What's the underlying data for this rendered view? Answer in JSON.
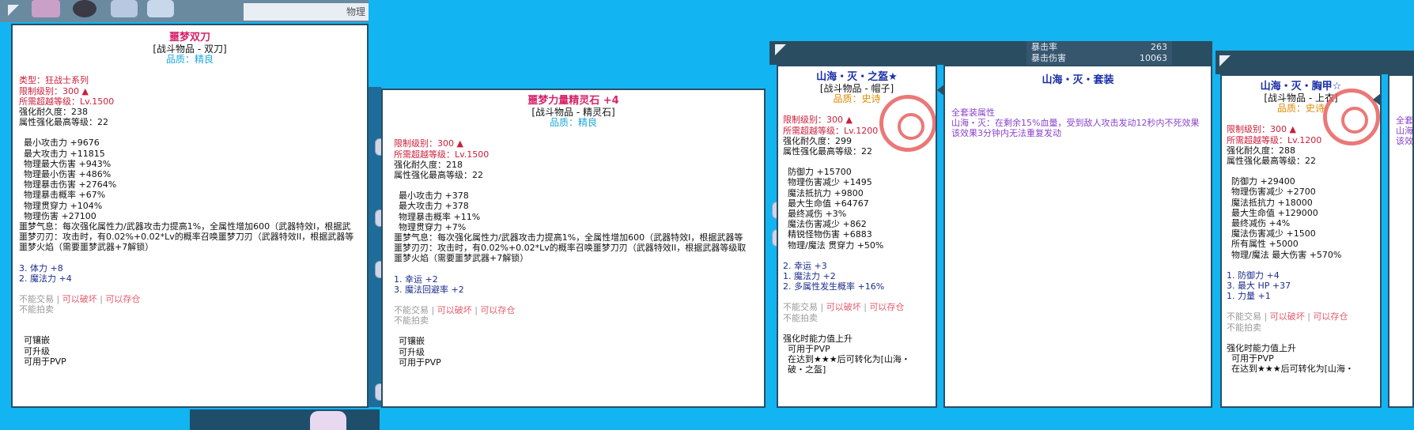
{
  "screen": {
    "background": "#13b4f2"
  },
  "top_strip": {
    "label": "物理"
  },
  "top_strip2": {
    "rows": [
      {
        "label": "暴击率",
        "value": "263"
      },
      {
        "label": "暴击伤害",
        "value": "10063"
      }
    ]
  },
  "tip1": {
    "name": "噩梦双刀",
    "category": "[战斗物品 - 双刀]",
    "quality": "品质：精良",
    "type_line": "类型：狂战士系列",
    "req_level": "限制级别：300 ▲",
    "req_exceed": "所需超越等级：Lv.1500",
    "durability": "强化耐久度：238",
    "attr_max": "属性强化最高等级：22",
    "stats": [
      "最小攻击力 +9676",
      "最大攻击力 +11815",
      "物理最大伤害 +943%",
      "物理最小伤害 +486%",
      "物理暴击伤害 +2764%",
      "物理暴击概率 +67%",
      "物理贯穿力 +104%",
      "物理伤害 +27100"
    ],
    "effects": [
      "噩梦气息：每次强化属性力/武器攻击力提高1%，全属性增加600（武器特效I，根据武",
      "噩梦刃刃：攻击时，有0.02%+0.02*Lv的概率召唤噩梦刀刃（武器特效II，根据武器等",
      "噩梦火焰（需要噩梦武器+7解锁）"
    ],
    "bonus": [
      "3. 体力 +8",
      "2. 魔法力 +4"
    ],
    "trade": {
      "no_trade": "不能交易",
      "sep": "|",
      "breakable": "可以破坏",
      "storable": "可以存仓",
      "no_auction": "不能拍卖"
    },
    "abilities": [
      "可镶嵌",
      "可升级",
      "可用于PVP"
    ]
  },
  "tip2": {
    "name": "噩梦力量精灵石 +4",
    "category": "[战斗物品 - 精灵石]",
    "quality": "品质：精良",
    "req_level": "限制级别：300 ▲",
    "req_exceed": "所需超越等级：Lv.1500",
    "durability": "强化耐久度：218",
    "attr_max": "属性强化最高等级：22",
    "stats": [
      "最小攻击力 +378",
      "最大攻击力 +378",
      "物理暴击概率 +11%",
      "物理贯穿力 +7%"
    ],
    "effects": [
      "噩梦气息：每次强化属性力/武器攻击力提高1%，全属性增加600（武器特效I，根据武器等",
      "噩梦刃刃：攻击时，有0.02%+0.02*Lv的概率召唤噩梦刀刃（武器特效II，根据武器等级取",
      "噩梦火焰（需要噩梦武器+7解锁）"
    ],
    "bonus": [
      "1. 幸运 +2",
      "3. 魔法回避率 +2"
    ],
    "trade": {
      "no_trade": "不能交易",
      "sep": "|",
      "breakable": "可以破坏",
      "storable": "可以存仓",
      "no_auction": "不能拍卖"
    },
    "abilities": [
      "可镶嵌",
      "可升级",
      "可用于PVP"
    ]
  },
  "tip3": {
    "name": "山海・灭・之盔★",
    "category": "[战斗物品 - 帽子]",
    "quality": "品质：史诗",
    "req_level": "限制级别：300 ▲",
    "req_exceed": "所需超越等级：Lv.1200",
    "durability": "强化耐久度：299",
    "attr_max": "属性强化最高等级：22",
    "stats": [
      "防御力 +15700",
      "物理伤害减少 +1495",
      "魔法抵抗力 +9800",
      "最大生命值 +64767",
      "最终减伤 +3%",
      "魔法伤害减少 +862",
      "精锐怪物伤害 +6883",
      "物理/魔法 贯穿力 +50%"
    ],
    "bonus": [
      "2. 幸运 +3",
      "1. 魔法力 +2",
      "2. 多属性发生概率 +16%"
    ],
    "trade": {
      "no_trade": "不能交易",
      "sep": "|",
      "breakable": "可以破坏",
      "storable": "可以存仓",
      "no_auction": "不能拍卖"
    },
    "upgrade": [
      "强化时能力值上升",
      "可用于PVP",
      "在达到★★★后可转化为[山海・",
      "破・之盔]"
    ]
  },
  "setpanel": {
    "title": "山海・灭・套装",
    "full_set": "全套装属性",
    "effect1": "山海・灭：在剩余15%血量，受到敌人攻击发动12秒内不死效果",
    "effect2": "该效果3分钟内无法重复发动"
  },
  "tip4": {
    "name": "山海・灭・胸甲☆",
    "category": "[战斗物品 - 上衣]",
    "quality": "品质：史诗",
    "req_level": "限制级别：300 ▲",
    "req_exceed": "所需超越等级：Lv.1200",
    "durability": "强化耐久度：288",
    "attr_max": "属性强化最高等级：22",
    "stats": [
      "防御力 +29400",
      "物理伤害减少 +2700",
      "魔法抵抗力 +18000",
      "最大生命值 +129000",
      "最终减伤 +4%",
      "魔法伤害减少 +1500",
      "所有属性 +5000",
      "物理/魔法 最大伤害 +570%"
    ],
    "bonus": [
      "1. 防御力 +4",
      "3. 最大 HP +37",
      "1. 力量 +1"
    ],
    "trade": {
      "no_trade": "不能交易",
      "sep": "|",
      "breakable": "可以破坏",
      "storable": "可以存仓",
      "no_auction": "不能拍卖"
    },
    "upgrade": [
      "强化时能力值上升",
      "可用于PVP",
      "在达到★★★后可转化为[山海・"
    ]
  },
  "right_edge": {
    "line1": "全套",
    "line2": "山海",
    "line3": "该效"
  }
}
